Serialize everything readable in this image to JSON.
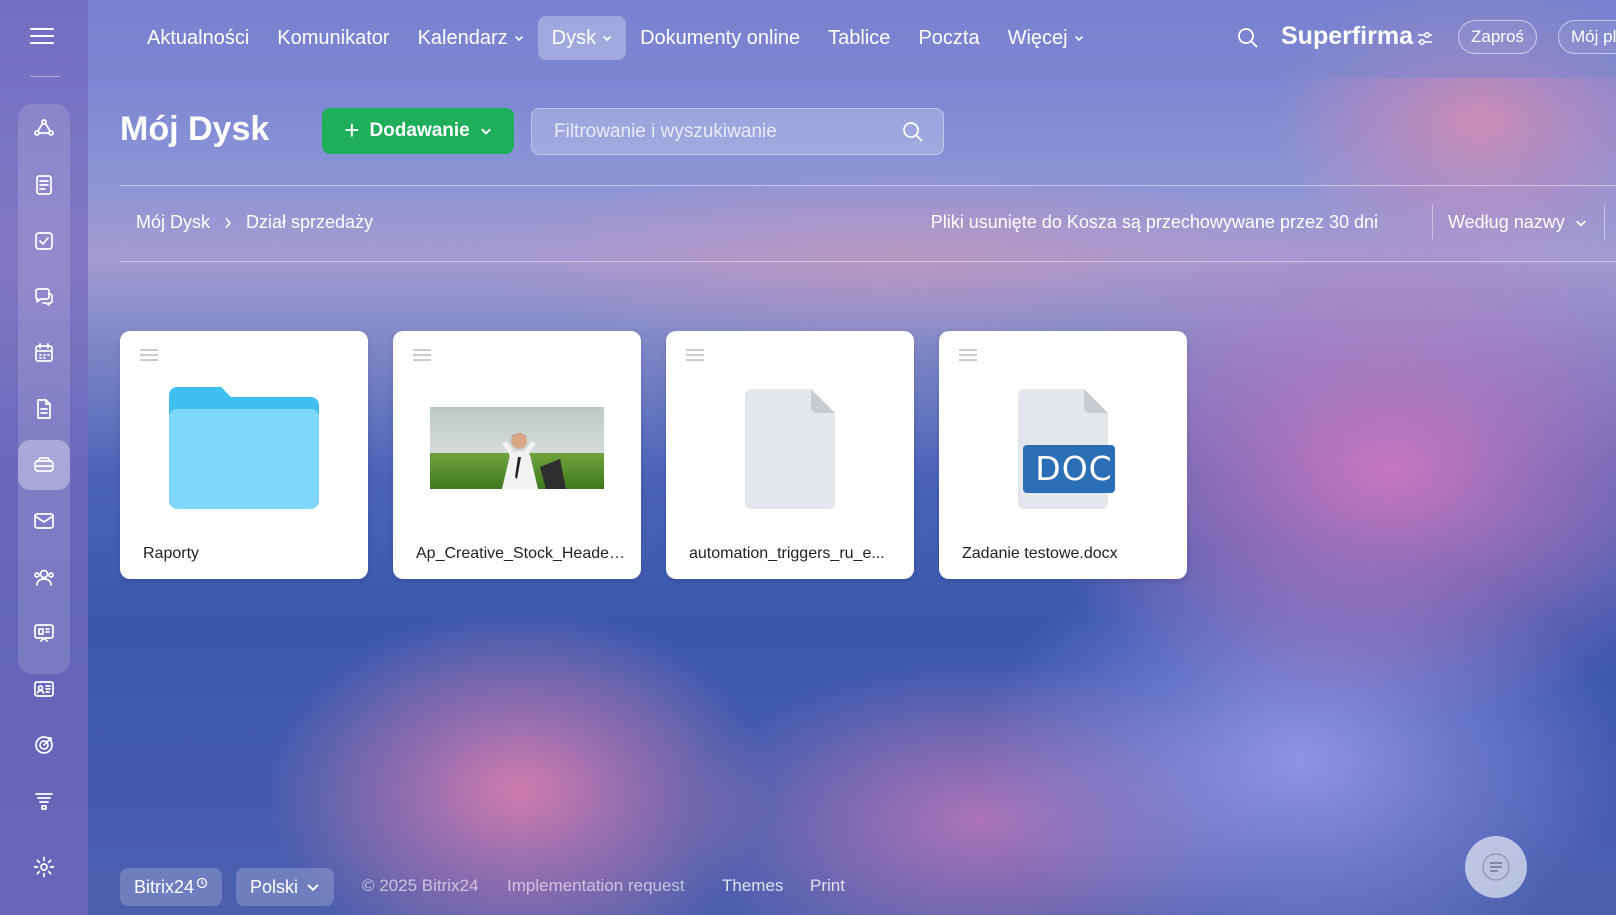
{
  "topnav": {
    "items": [
      {
        "label": "Aktualności",
        "dropdown": false,
        "active": false
      },
      {
        "label": "Komunikator",
        "dropdown": false,
        "active": false
      },
      {
        "label": "Kalendarz",
        "dropdown": true,
        "active": false
      },
      {
        "label": "Dysk",
        "dropdown": true,
        "active": true
      },
      {
        "label": "Dokumenty online",
        "dropdown": false,
        "active": false
      },
      {
        "label": "Tablice",
        "dropdown": false,
        "active": false
      },
      {
        "label": "Poczta",
        "dropdown": false,
        "active": false
      },
      {
        "label": "Więcej",
        "dropdown": true,
        "active": false
      }
    ],
    "brand": "Superfirma",
    "invite_label": "Zaproś",
    "plan_label": "Mój pla"
  },
  "sidebar": {
    "icons": [
      "ai-assistant-icon",
      "feed-icon",
      "tasks-icon",
      "chat-icon",
      "calendar-icon",
      "document-icon",
      "drive-icon",
      "mail-icon",
      "contacts-icon",
      "board-icon",
      "crm-card-icon",
      "goals-icon",
      "funnel-icon",
      "settings-icon"
    ],
    "active": "drive-icon"
  },
  "header": {
    "title": "Mój Dysk",
    "add_label": "Dodawanie",
    "search_placeholder": "Filtrowanie i wyszukiwanie"
  },
  "breadcrumb": {
    "items": [
      "Mój Dysk",
      "Dział sprzedaży"
    ]
  },
  "toolbar": {
    "trash_note": "Pliki usunięte do Kosza są przechowywane przez 30 dni",
    "sort_label": "Według nazwy"
  },
  "files": [
    {
      "name": "Raporty",
      "kind": "folder"
    },
    {
      "name": "Ap_Creative_Stock_Header...",
      "kind": "image"
    },
    {
      "name": "automation_triggers_ru_e...",
      "kind": "file"
    },
    {
      "name": "Zadanie testowe.docx",
      "kind": "doc",
      "badge": "DOC"
    }
  ],
  "footer": {
    "brand": "Bitrix24",
    "language": "Polski",
    "copyright": "© 2025 Bitrix24",
    "links": [
      "Implementation request",
      "Themes",
      "Print"
    ]
  },
  "colors": {
    "accent_green": "#1fae5a",
    "folder_blue": "#7fd8fb",
    "doc_blue": "#2a6fb5"
  }
}
